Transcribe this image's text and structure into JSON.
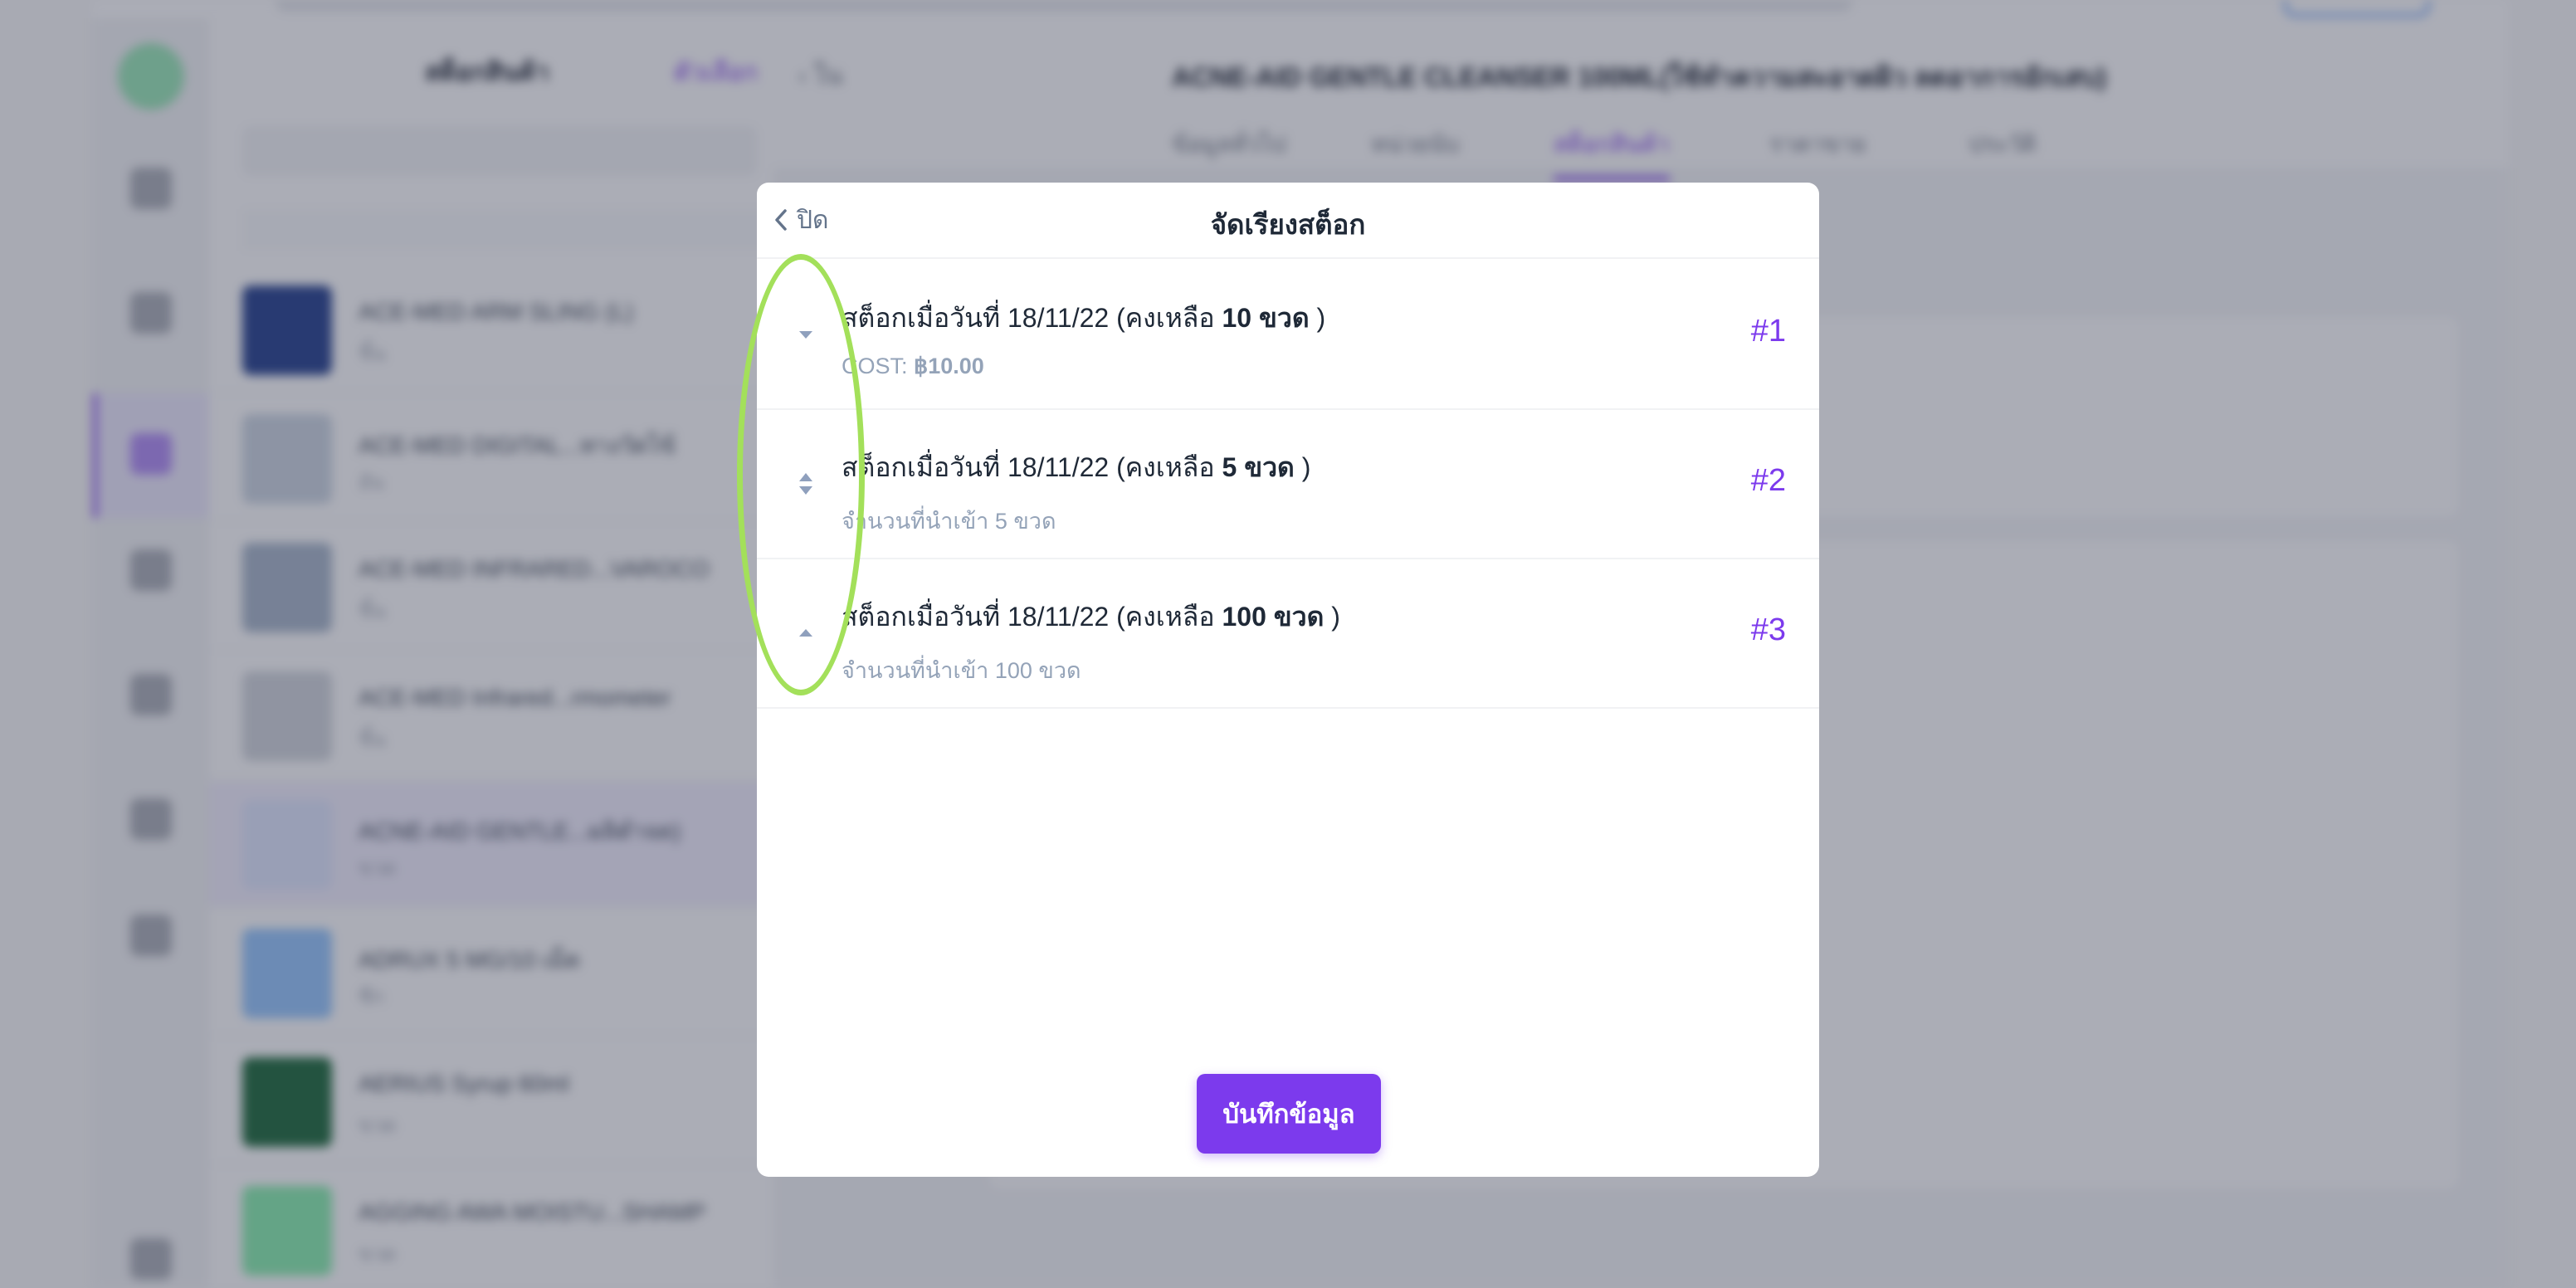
{
  "background": {
    "list_header": {
      "title": "สต็อกสินค้า",
      "link": "ตัวเลือก"
    },
    "list_rows": [
      {
        "name": "ACE-MED ARM SLING (L)",
        "sub": "ชิ้น"
      },
      {
        "name": "ACE-MED DIGITAL...ทางวัดไข้",
        "sub": "อัน"
      },
      {
        "name": "ACE-MED INFRARED...VAROCO",
        "sub": "ชิ้น"
      },
      {
        "name": "ACE-MED Infrared...rmometer",
        "sub": "ชิ้น"
      },
      {
        "name": "ACNE-AID GENTLE...ผลิตำจด)",
        "sub": "ขวด"
      },
      {
        "name": "ADRUX 5 MG/10 เม็ด",
        "sub": "ซีก"
      },
      {
        "name": "AERIUS Syrup 60ml",
        "sub": "ขวด"
      },
      {
        "name": "AGGING AWA MOISTU...SHAMP",
        "sub": "ขวด"
      }
    ],
    "detail_title": "ACNE-AID GENTLE CLEANSER 100ML(ใช้ทำความสะอาดผิว ลดอาการอักเสบ)",
    "back_label": "‹ ใน",
    "tabs": [
      "ข้อมูลทั่วไป",
      "หน่วยนับ",
      "สต็อกสินค้า",
      "ราคาขาย",
      "ประวัติ"
    ]
  },
  "modal": {
    "close_label": "ปิด",
    "title": "จัดเรียงสต็อก",
    "items": [
      {
        "prefix": "สต็อกเมื่อวันที่ 18/11/22 (คงเหลือ ",
        "qty": "10 ขวด",
        "suffix": " )",
        "sub_prefix": "COST: ",
        "sub_value": "฿10.00",
        "rank": "#1",
        "handle_icon": "chevron-down-icon"
      },
      {
        "prefix": "สต็อกเมื่อวันที่ 18/11/22 (คงเหลือ ",
        "qty": "5 ขวด",
        "suffix": " )",
        "sub_prefix": "จำนวนที่นำเข้า 5 ขวด",
        "sub_value": "",
        "rank": "#2",
        "handle_icon": "sort-up-down-icon"
      },
      {
        "prefix": "สต็อกเมื่อวันที่ 18/11/22 (คงเหลือ ",
        "qty": "100 ขวด",
        "suffix": " )",
        "sub_prefix": "จำนวนที่นำเข้า 100 ขวด",
        "sub_value": "",
        "rank": "#3",
        "handle_icon": "chevron-up-icon"
      }
    ],
    "save_label": "บันทึกข้อมูล"
  },
  "colors": {
    "accent": "#7c3aed",
    "muted_text": "#94a3b8",
    "highlight": "#a3e05a"
  }
}
